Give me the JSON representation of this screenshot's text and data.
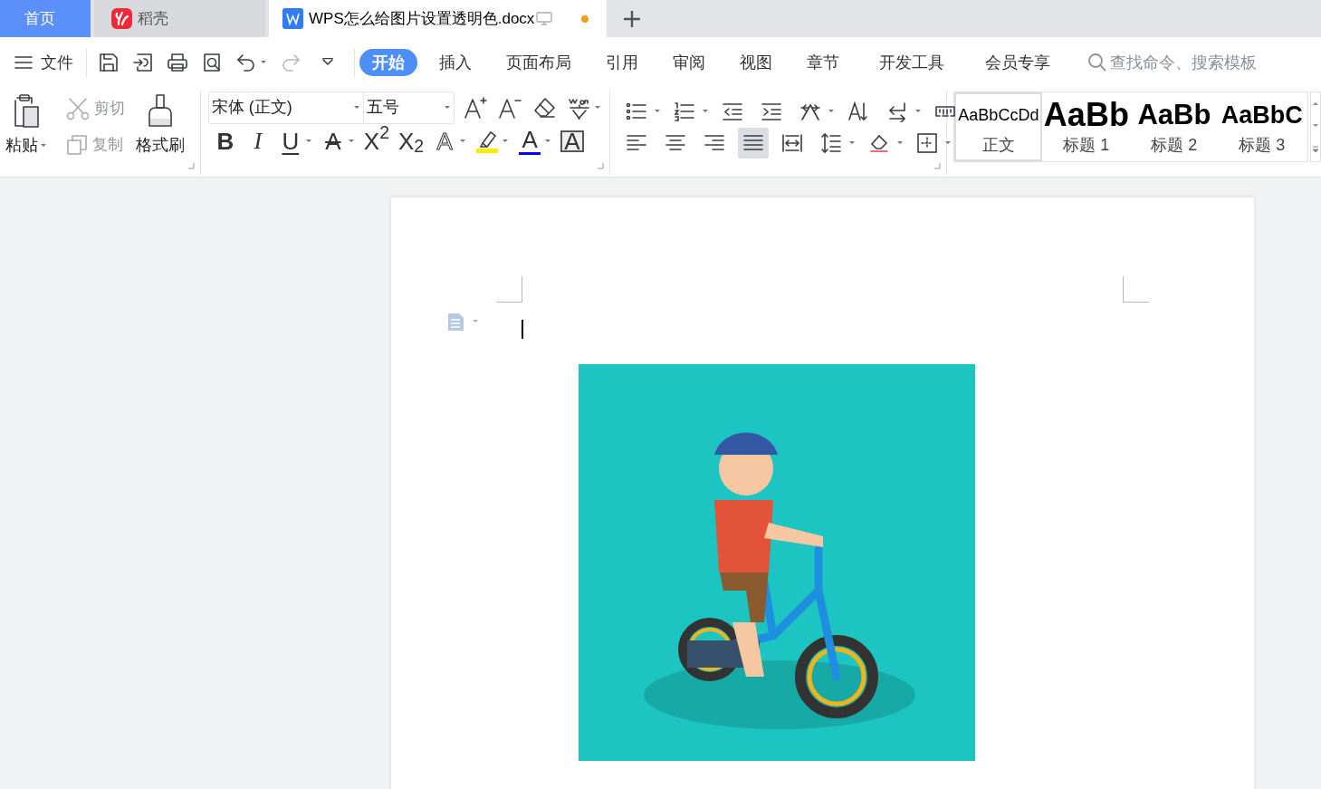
{
  "title_tabs": [
    {
      "kind": "home",
      "label": "首页",
      "selected": false
    },
    {
      "kind": "docer",
      "label": "稻壳",
      "selected": false
    },
    {
      "kind": "document",
      "label": "WPS怎么给图片设置透明色.docx",
      "selected": true,
      "modified": true
    }
  ],
  "menu": {
    "file_label": "文件",
    "ribbon_tabs": [
      {
        "label": "开始",
        "selected": true
      },
      {
        "label": "插入",
        "selected": false
      },
      {
        "label": "页面布局",
        "selected": false
      },
      {
        "label": "引用",
        "selected": false
      },
      {
        "label": "审阅",
        "selected": false
      },
      {
        "label": "视图",
        "selected": false
      },
      {
        "label": "章节",
        "selected": false
      },
      {
        "label": "开发工具",
        "selected": false
      },
      {
        "label": "会员专享",
        "selected": false
      }
    ],
    "search": {
      "placeholder": "查找命令、搜索模板"
    }
  },
  "clipboard": {
    "paste": "粘贴",
    "cut": {
      "label": "剪切",
      "disabled": true
    },
    "copy": {
      "label": "复制",
      "disabled": true
    },
    "format_painter": "格式刷"
  },
  "font": {
    "name": "宋体 (正文)",
    "size": "五号",
    "format_buttons": [
      {
        "kind": "bold",
        "glyph": "B",
        "dropdown": false
      },
      {
        "kind": "italic",
        "glyph": "I",
        "dropdown": false
      },
      {
        "kind": "underline",
        "glyph": "U",
        "dropdown": true
      },
      {
        "kind": "strikethrough",
        "glyph": "A",
        "dropdown": true
      },
      {
        "kind": "superscript",
        "glyph": "X$^{2}$",
        "dropdown": false
      },
      {
        "kind": "subscript",
        "glyph": "X$_{2}$",
        "dropdown": false
      },
      {
        "kind": "text_effect",
        "glyph": "A",
        "dropdown": true
      },
      {
        "kind": "highlight",
        "color": "#ffeb00",
        "dropdown": true
      },
      {
        "kind": "font_color",
        "glyph": "A",
        "color": "#0000ff",
        "dropdown": true
      },
      {
        "kind": "char_border",
        "glyph": "A",
        "dropdown": false
      }
    ]
  },
  "paragraph": {
    "row_1": [
      {
        "kind": "bullets",
        "dropdown": true
      },
      {
        "kind": "numbering",
        "dropdown": true
      },
      {
        "kind": "outdent",
        "dropdown": false
      },
      {
        "kind": "indent",
        "dropdown": false
      },
      {
        "kind": "chinese_layout",
        "dropdown": true
      },
      {
        "kind": "sort",
        "dropdown": false
      },
      {
        "kind": "marks",
        "dropdown": true
      },
      {
        "kind": "ruler",
        "dropdown": false
      }
    ],
    "row_2": [
      {
        "kind": "align_left",
        "selected": false,
        "dropdown": false
      },
      {
        "kind": "align_center",
        "selected": false,
        "dropdown": false
      },
      {
        "kind": "align_right",
        "selected": false,
        "dropdown": false
      },
      {
        "kind": "justify",
        "selected": true,
        "dropdown": false
      },
      {
        "kind": "distributed",
        "selected": false,
        "dropdown": false
      },
      {
        "kind": "line_spacing",
        "selected": false,
        "dropdown": true
      },
      {
        "kind": "shading",
        "selected": false,
        "dropdown": true
      },
      {
        "kind": "borders",
        "selected": false,
        "dropdown": true
      }
    ]
  },
  "styles": [
    {
      "preview": "AaBbCcDd",
      "label": "正文",
      "selected": true
    },
    {
      "preview": "AaBb",
      "label": "标题 1",
      "selected": false
    },
    {
      "preview": "AaBb",
      "label": "标题 2",
      "selected": false
    },
    {
      "preview": "AaBbC",
      "label": "标题 3",
      "selected": false
    }
  ]
}
